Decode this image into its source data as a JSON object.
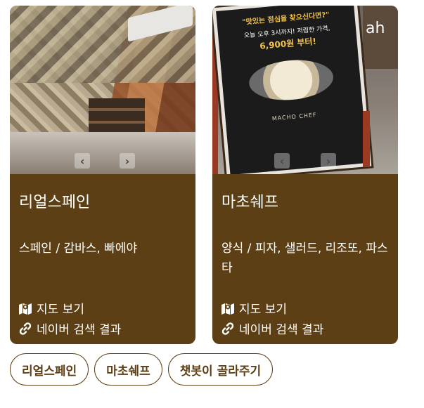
{
  "cards": [
    {
      "title": "리얼스페인",
      "description": "스페인 / 감바스, 빠에야",
      "map_link": "지도 보기",
      "search_link": "네이버 검색 결과",
      "photo_icon": "restaurant-interior-photo"
    },
    {
      "title": "마초쉐프",
      "description": "양식 / 피자, 샐러드, 리조또, 파스타",
      "map_link": "지도 보기",
      "search_link": "네이버 검색 결과",
      "photo_icon": "menu-board-photo",
      "photo_text": {
        "headline": "\"맛있는 점심을 찾으신다면?\"",
        "offer": "오늘 오후 3시까지! 저렴한 가격,",
        "price": "6,900원 부터!",
        "brand": "MACHO CHEF"
      }
    }
  ],
  "quick_replies": [
    "리얼스페인",
    "마초쉐프",
    "챗봇이 골라주기"
  ],
  "colors": {
    "card_bg": "#5c3f15",
    "text_on_card": "#ffffff",
    "chip_border": "#5c3f15",
    "chip_text": "#5c3f15"
  },
  "icons": {
    "map": "map-icon",
    "link": "link-icon",
    "prev": "chevron-left-icon",
    "next": "chevron-right-icon"
  }
}
